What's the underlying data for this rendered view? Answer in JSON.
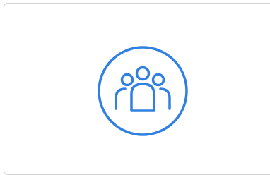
{
  "card": {
    "icon": "users-group-icon",
    "accent_color": "#2f80e0",
    "border_color": "#d4d4d4",
    "background_color": "#ffffff"
  }
}
